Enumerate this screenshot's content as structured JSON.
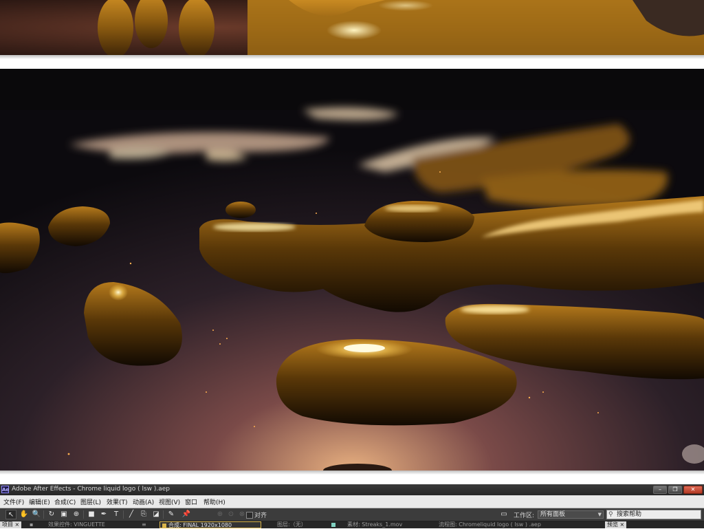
{
  "app": {
    "title": "Adobe After Effects - Chrome liquid logo ( lsw ).aep",
    "logo_text": "Ae"
  },
  "window_controls": {
    "minimize": "–",
    "restore": "❐",
    "close": "✕"
  },
  "menu": [
    "文件(F)",
    "编辑(E)",
    "合成(C)",
    "图层(L)",
    "效果(T)",
    "动画(A)",
    "视图(V)",
    "窗口",
    "帮助(H)"
  ],
  "toolbar": {
    "tools": [
      "selection-tool",
      "hand-tool",
      "zoom-tool",
      "rotate-tool",
      "camera-tool",
      "pan-behind-tool",
      "rectangle-tool",
      "pen-tool",
      "text-tool",
      "brush-tool",
      "clone-stamp-tool",
      "eraser-tool",
      "roto-brush-tool",
      "puppet-pin-tool"
    ],
    "tool_glyphs": [
      "↖",
      "✋",
      "🔍",
      "↻",
      "▣",
      "⊕",
      "■",
      "✒",
      "T",
      "╱",
      "⎘",
      "◪",
      "✎",
      "📌"
    ],
    "align_label": "对齐",
    "workspace_label": "工作区:",
    "workspace_value": "所有面板",
    "search_placeholder": "搜索帮助"
  },
  "panel_tabs": {
    "project": "项目",
    "effect_controls": "效果控件: VINGUETTE",
    "composition": "合成: FINAL 1920x1080",
    "layer": "图层:（无）",
    "footage": "素材: Streaks_1.mov",
    "flowchart": "流程图: Chromeliquid logo ( lsw ) .aep",
    "preview": "预览"
  },
  "colors": {
    "accent_gold": "#d9a030",
    "liquid_dark": "#2a1a08",
    "background_purple": "#3a2a32"
  }
}
